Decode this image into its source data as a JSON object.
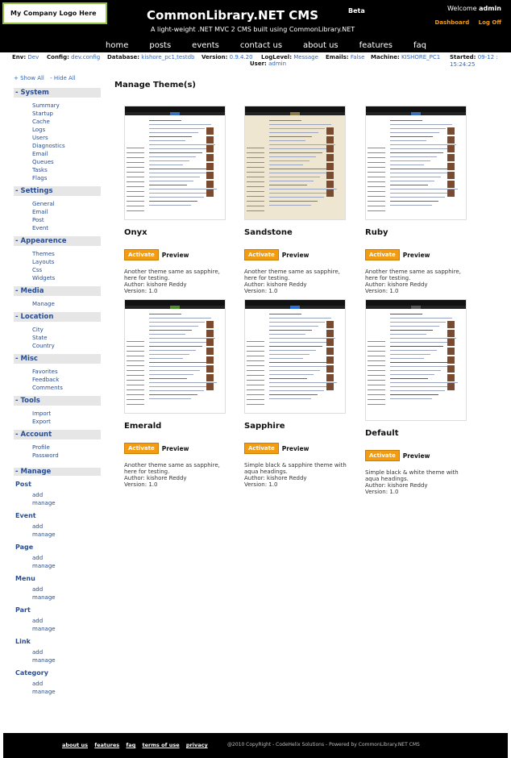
{
  "header": {
    "logo": "My Company Logo Here",
    "title": "CommonLibrary.NET CMS",
    "beta": "Beta",
    "tagline": "A light-weight .NET MVC 2 CMS built using CommonLibrary.NET",
    "welcome": "Welcome",
    "username": "admin",
    "dashboard": "Dashboard",
    "logoff": "Log Off",
    "nav": [
      "home",
      "posts",
      "events",
      "contact us",
      "about us",
      "features",
      "faq"
    ]
  },
  "infobar": {
    "env_label": "Env:",
    "env": "Dev",
    "config_label": "Config:",
    "config": "dev.config",
    "db_label": "Database:",
    "db": "kishore_pc1,testdb",
    "version_label": "Version:",
    "version": "0.9.4.20",
    "loglevel_label": "LogLevel:",
    "loglevel": "Message",
    "emails_label": "Emails:",
    "emails": "False",
    "machine_label": "Machine:",
    "machine": "KISHORE_PC1",
    "started_label": "Started:",
    "started": "09-12 : 15:24:25",
    "user_label": "User:",
    "user": "admin"
  },
  "sidebar": {
    "show_all": "+ Show All",
    "hide_all": "- Hide All",
    "groups": [
      {
        "label": "- System",
        "items": [
          "Summary",
          "Startup",
          "Cache",
          "Logs",
          "Users",
          "Diagnostics",
          "Email",
          "Queues",
          "Tasks",
          "Flags"
        ]
      },
      {
        "label": "- Settings",
        "items": [
          "General",
          "Email",
          "Post",
          "Event"
        ]
      },
      {
        "label": "- Appearence",
        "items": [
          "Themes",
          "Layouts",
          "Css",
          "Widgets"
        ]
      },
      {
        "label": "- Media",
        "items": [
          "Manage"
        ]
      },
      {
        "label": "- Location",
        "items": [
          "City",
          "State",
          "Country"
        ]
      },
      {
        "label": "- Misc",
        "items": [
          "Favorites",
          "Feedback",
          "Comments"
        ]
      },
      {
        "label": "- Tools",
        "items": [
          "Import",
          "Export"
        ]
      },
      {
        "label": "- Account",
        "items": [
          "Profile",
          "Password"
        ]
      }
    ],
    "manage_label": "- Manage",
    "manage": [
      {
        "name": "Post",
        "add": "add",
        "manage": "manage"
      },
      {
        "name": "Event",
        "add": "add",
        "manage": "manage"
      },
      {
        "name": "Page",
        "add": "add",
        "manage": "manage"
      },
      {
        "name": "Menu",
        "add": "add",
        "manage": "manage"
      },
      {
        "name": "Part",
        "add": "add",
        "manage": "manage"
      },
      {
        "name": "Link",
        "add": "add",
        "manage": "manage"
      },
      {
        "name": "Category",
        "add": "add",
        "manage": "manage"
      }
    ]
  },
  "main": {
    "title": "Manage Theme(s)",
    "activate": "Activate",
    "preview": "Preview",
    "themes": [
      {
        "name": "Onyx",
        "desc": "Another theme same as sapphire, here for testing.",
        "author": "Author: kishore Reddy",
        "version": "Version: 1.0",
        "bg": "#ffffff",
        "accent": "#3b6fb6"
      },
      {
        "name": "Sandstone",
        "desc": "Another theme same as sapphire, here for testing.",
        "author": "Author: kishore Reddy",
        "version": "Version: 1.0",
        "bg": "#efe6d2",
        "accent": "#8a7a4a"
      },
      {
        "name": "Ruby",
        "desc": "Another theme same as sapphire, here for testing.",
        "author": "Author: kishore Reddy",
        "version": "Version: 1.0",
        "bg": "#ffffff",
        "accent": "#3b6fb6"
      },
      {
        "name": "Emerald",
        "desc": "Another theme same as sapphire, here for testing.",
        "author": "Author: kishore Reddy",
        "version": "Version: 1.0",
        "bg": "#ffffff",
        "accent": "#4f8a2a"
      },
      {
        "name": "Sapphire",
        "desc": "Simple black & sapphire theme with aqua headings.",
        "author": "Author: kishore Reddy",
        "version": "Version: 1.0",
        "bg": "#ffffff",
        "accent": "#2a6fd6"
      },
      {
        "name": "Default",
        "desc": "Simple black & white theme with aqua headings.",
        "author": "Author: kishore Reddy",
        "version": "Version: 1.0",
        "bg": "#ffffff",
        "accent": "#555555"
      }
    ]
  },
  "footer": {
    "links": [
      "about us",
      "features",
      "faq",
      "terms of use",
      "privacy"
    ],
    "copyright": "@2010 CopyRight - CodeHelix Solutions - Powered by CommonLibrary.NET CMS"
  }
}
